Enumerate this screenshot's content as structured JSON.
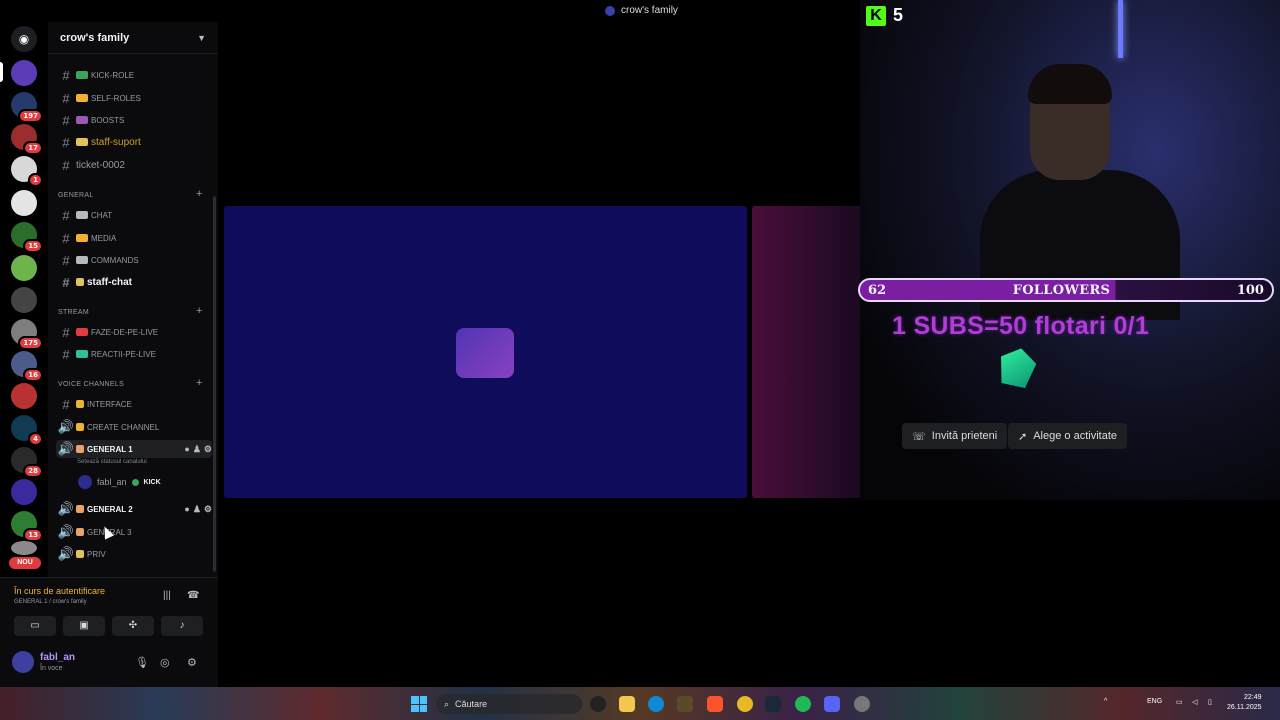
{
  "window": {
    "title": "crow's family"
  },
  "rail": {
    "badges": [
      "197",
      "17",
      "1",
      "15",
      "175",
      "16",
      "4",
      "28",
      "13"
    ],
    "new_label": "NOU"
  },
  "sidebar": {
    "guild_name": "crow's family",
    "channels_top": [
      {
        "name": "KICK-ROLE"
      },
      {
        "name": "SELF-ROLES"
      },
      {
        "name": "BOOSTS"
      },
      {
        "name": "staff-suport"
      },
      {
        "name": "ticket-0002"
      }
    ],
    "category_general": "GENERAL",
    "channels_general": [
      {
        "name": "CHAT"
      },
      {
        "name": "MEDIA"
      },
      {
        "name": "COMMANDS"
      },
      {
        "name": "staff-chat"
      }
    ],
    "category_stream": "STREAM",
    "channels_stream": [
      {
        "name": "FAZE-DE-PE-LIVE"
      },
      {
        "name": "REACTII-PE-LIVE"
      }
    ],
    "category_voice": "VOICE CHANNELS",
    "channels_voice": [
      {
        "name": "INTERFACE"
      },
      {
        "name": "CREATE CHANNEL"
      },
      {
        "name": "GENERAL 1"
      },
      {
        "name": "GENERAL 2"
      },
      {
        "name": "GENERAL 3"
      },
      {
        "name": "PRIV"
      }
    ],
    "voice_status_hint": "Setează statusul canalului",
    "voice_user": {
      "name": "fabl_an",
      "tag": "KICK"
    }
  },
  "rtc": {
    "status": "În curs de autentificare",
    "location": "GENERAL 1 / crow's family"
  },
  "user_panel": {
    "name": "fabl_an",
    "state": "În voce"
  },
  "stage": {
    "invite_label": "Invită prieteni",
    "activity_label": "Alege o activitate"
  },
  "overlay": {
    "kick_count": "5",
    "followers_current": "62",
    "followers_label": "FOLLOWERS",
    "followers_goal": "100",
    "subs_text": "1 SUBS=50 flotari 0/1"
  },
  "taskbar": {
    "search_placeholder": "Căutare",
    "lang": "ENG",
    "time": "22:49",
    "date": "26.11.2025"
  }
}
